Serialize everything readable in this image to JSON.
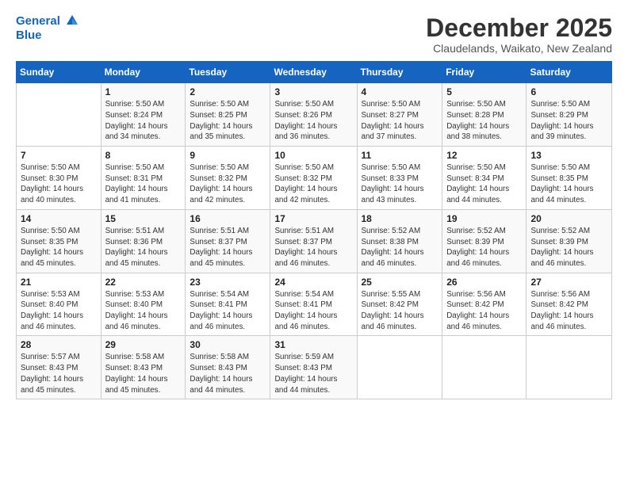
{
  "logo": {
    "line1": "General",
    "line2": "Blue"
  },
  "title": "December 2025",
  "location": "Claudelands, Waikato, New Zealand",
  "header_days": [
    "Sunday",
    "Monday",
    "Tuesday",
    "Wednesday",
    "Thursday",
    "Friday",
    "Saturday"
  ],
  "weeks": [
    [
      {
        "day": "",
        "info": ""
      },
      {
        "day": "1",
        "info": "Sunrise: 5:50 AM\nSunset: 8:24 PM\nDaylight: 14 hours\nand 34 minutes."
      },
      {
        "day": "2",
        "info": "Sunrise: 5:50 AM\nSunset: 8:25 PM\nDaylight: 14 hours\nand 35 minutes."
      },
      {
        "day": "3",
        "info": "Sunrise: 5:50 AM\nSunset: 8:26 PM\nDaylight: 14 hours\nand 36 minutes."
      },
      {
        "day": "4",
        "info": "Sunrise: 5:50 AM\nSunset: 8:27 PM\nDaylight: 14 hours\nand 37 minutes."
      },
      {
        "day": "5",
        "info": "Sunrise: 5:50 AM\nSunset: 8:28 PM\nDaylight: 14 hours\nand 38 minutes."
      },
      {
        "day": "6",
        "info": "Sunrise: 5:50 AM\nSunset: 8:29 PM\nDaylight: 14 hours\nand 39 minutes."
      }
    ],
    [
      {
        "day": "7",
        "info": "Sunrise: 5:50 AM\nSunset: 8:30 PM\nDaylight: 14 hours\nand 40 minutes."
      },
      {
        "day": "8",
        "info": "Sunrise: 5:50 AM\nSunset: 8:31 PM\nDaylight: 14 hours\nand 41 minutes."
      },
      {
        "day": "9",
        "info": "Sunrise: 5:50 AM\nSunset: 8:32 PM\nDaylight: 14 hours\nand 42 minutes."
      },
      {
        "day": "10",
        "info": "Sunrise: 5:50 AM\nSunset: 8:32 PM\nDaylight: 14 hours\nand 42 minutes."
      },
      {
        "day": "11",
        "info": "Sunrise: 5:50 AM\nSunset: 8:33 PM\nDaylight: 14 hours\nand 43 minutes."
      },
      {
        "day": "12",
        "info": "Sunrise: 5:50 AM\nSunset: 8:34 PM\nDaylight: 14 hours\nand 44 minutes."
      },
      {
        "day": "13",
        "info": "Sunrise: 5:50 AM\nSunset: 8:35 PM\nDaylight: 14 hours\nand 44 minutes."
      }
    ],
    [
      {
        "day": "14",
        "info": "Sunrise: 5:50 AM\nSunset: 8:35 PM\nDaylight: 14 hours\nand 45 minutes."
      },
      {
        "day": "15",
        "info": "Sunrise: 5:51 AM\nSunset: 8:36 PM\nDaylight: 14 hours\nand 45 minutes."
      },
      {
        "day": "16",
        "info": "Sunrise: 5:51 AM\nSunset: 8:37 PM\nDaylight: 14 hours\nand 45 minutes."
      },
      {
        "day": "17",
        "info": "Sunrise: 5:51 AM\nSunset: 8:37 PM\nDaylight: 14 hours\nand 46 minutes."
      },
      {
        "day": "18",
        "info": "Sunrise: 5:52 AM\nSunset: 8:38 PM\nDaylight: 14 hours\nand 46 minutes."
      },
      {
        "day": "19",
        "info": "Sunrise: 5:52 AM\nSunset: 8:39 PM\nDaylight: 14 hours\nand 46 minutes."
      },
      {
        "day": "20",
        "info": "Sunrise: 5:52 AM\nSunset: 8:39 PM\nDaylight: 14 hours\nand 46 minutes."
      }
    ],
    [
      {
        "day": "21",
        "info": "Sunrise: 5:53 AM\nSunset: 8:40 PM\nDaylight: 14 hours\nand 46 minutes."
      },
      {
        "day": "22",
        "info": "Sunrise: 5:53 AM\nSunset: 8:40 PM\nDaylight: 14 hours\nand 46 minutes."
      },
      {
        "day": "23",
        "info": "Sunrise: 5:54 AM\nSunset: 8:41 PM\nDaylight: 14 hours\nand 46 minutes."
      },
      {
        "day": "24",
        "info": "Sunrise: 5:54 AM\nSunset: 8:41 PM\nDaylight: 14 hours\nand 46 minutes."
      },
      {
        "day": "25",
        "info": "Sunrise: 5:55 AM\nSunset: 8:42 PM\nDaylight: 14 hours\nand 46 minutes."
      },
      {
        "day": "26",
        "info": "Sunrise: 5:56 AM\nSunset: 8:42 PM\nDaylight: 14 hours\nand 46 minutes."
      },
      {
        "day": "27",
        "info": "Sunrise: 5:56 AM\nSunset: 8:42 PM\nDaylight: 14 hours\nand 46 minutes."
      }
    ],
    [
      {
        "day": "28",
        "info": "Sunrise: 5:57 AM\nSunset: 8:43 PM\nDaylight: 14 hours\nand 45 minutes."
      },
      {
        "day": "29",
        "info": "Sunrise: 5:58 AM\nSunset: 8:43 PM\nDaylight: 14 hours\nand 45 minutes."
      },
      {
        "day": "30",
        "info": "Sunrise: 5:58 AM\nSunset: 8:43 PM\nDaylight: 14 hours\nand 44 minutes."
      },
      {
        "day": "31",
        "info": "Sunrise: 5:59 AM\nSunset: 8:43 PM\nDaylight: 14 hours\nand 44 minutes."
      },
      {
        "day": "",
        "info": ""
      },
      {
        "day": "",
        "info": ""
      },
      {
        "day": "",
        "info": ""
      }
    ]
  ]
}
